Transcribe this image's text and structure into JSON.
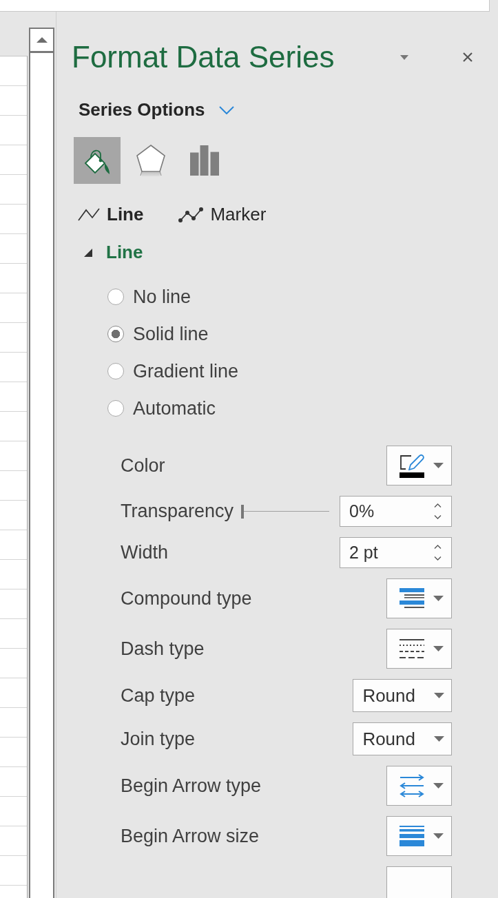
{
  "pane_title": "Format Data Series",
  "options_menu": {
    "label": "Series Options"
  },
  "category_tabs": [
    {
      "selected": true
    },
    {
      "selected": false
    },
    {
      "selected": false
    }
  ],
  "subtabs": [
    {
      "label": "Line",
      "selected": true
    },
    {
      "label": "Marker",
      "selected": false
    }
  ],
  "section": {
    "title": "Line",
    "expanded": true
  },
  "line_options": [
    {
      "label": "No line",
      "selected": false
    },
    {
      "label": "Solid line",
      "selected": true
    },
    {
      "label": "Gradient line",
      "selected": false
    },
    {
      "label": "Automatic",
      "selected": false
    }
  ],
  "properties": [
    {
      "kind": "picker",
      "label": "Color",
      "color": "#000000"
    },
    {
      "kind": "slider",
      "label": "Transparency",
      "level": 0,
      "value": "0%"
    },
    {
      "kind": "spin",
      "label": "Width",
      "value": "2 pt"
    },
    {
      "kind": "picker",
      "label": "Compound type"
    },
    {
      "kind": "picker",
      "label": "Dash type"
    },
    {
      "kind": "dropdown",
      "label": "Cap type",
      "value": "Round"
    },
    {
      "kind": "dropdown",
      "label": "Join type",
      "value": "Round"
    },
    {
      "kind": "picker",
      "label": "Begin Arrow type"
    },
    {
      "kind": "picker",
      "label": "Begin Arrow size"
    },
    {
      "kind": "clipped"
    }
  ]
}
